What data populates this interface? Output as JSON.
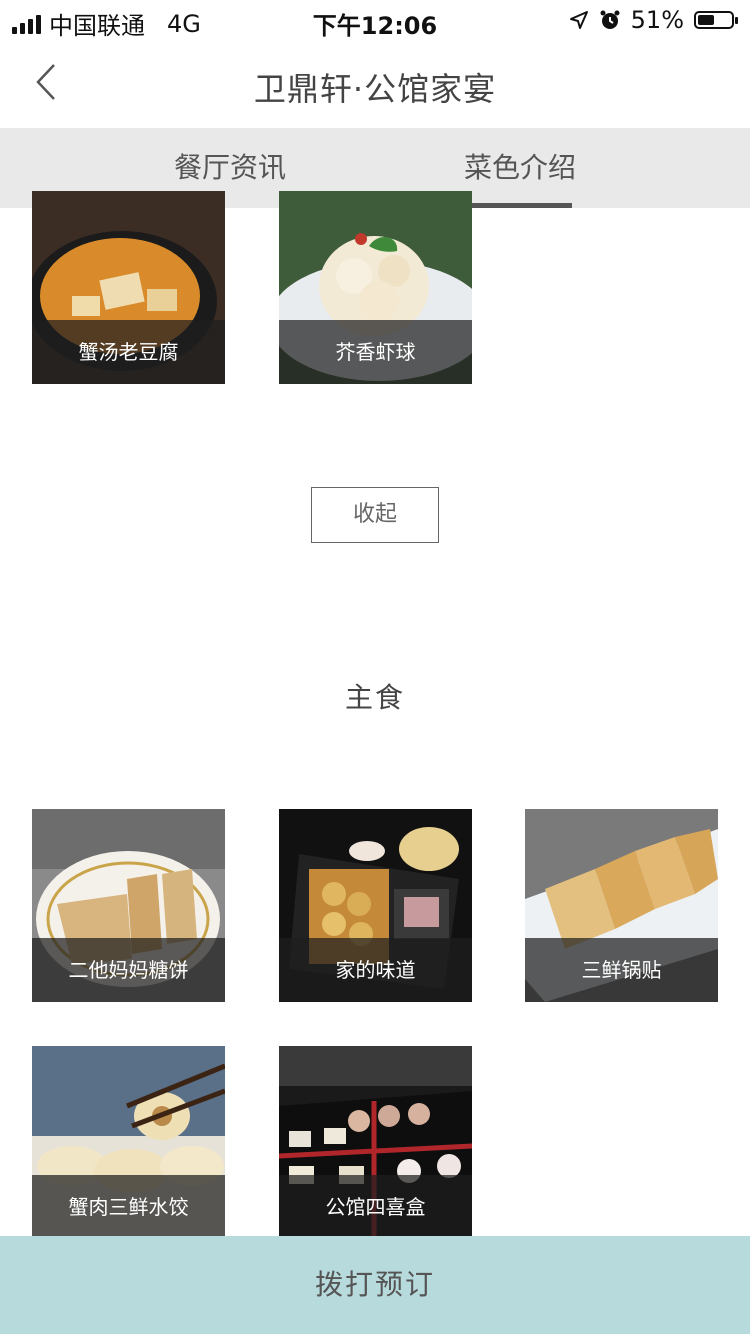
{
  "status_bar": {
    "carrier": "中国联通",
    "network": "4G",
    "time": "下午12:06",
    "battery": "51%",
    "battery_level": 0.51
  },
  "nav": {
    "title": "卫鼎轩·公馆家宴"
  },
  "tabs": [
    {
      "label": "餐厅资讯",
      "selected": false
    },
    {
      "label": "菜色介绍",
      "selected": true
    }
  ],
  "dishes_prev_section": [
    {
      "name": "蟹汤老豆腐"
    },
    {
      "name": "芥香虾球"
    }
  ],
  "collapse_label": "收起",
  "staple_section": {
    "title": "主食",
    "dishes": [
      {
        "name": "二他妈妈糖饼"
      },
      {
        "name": "家的味道"
      },
      {
        "name": "三鲜锅贴"
      },
      {
        "name": "蟹肉三鲜水饺"
      },
      {
        "name": "公馆四喜盒"
      }
    ]
  },
  "call_button": "拨打预订",
  "colors": {
    "tab_bg": "#e9e9e9",
    "call_bar_bg": "#b7dadd",
    "caption_bg": "#1e1e1e"
  }
}
